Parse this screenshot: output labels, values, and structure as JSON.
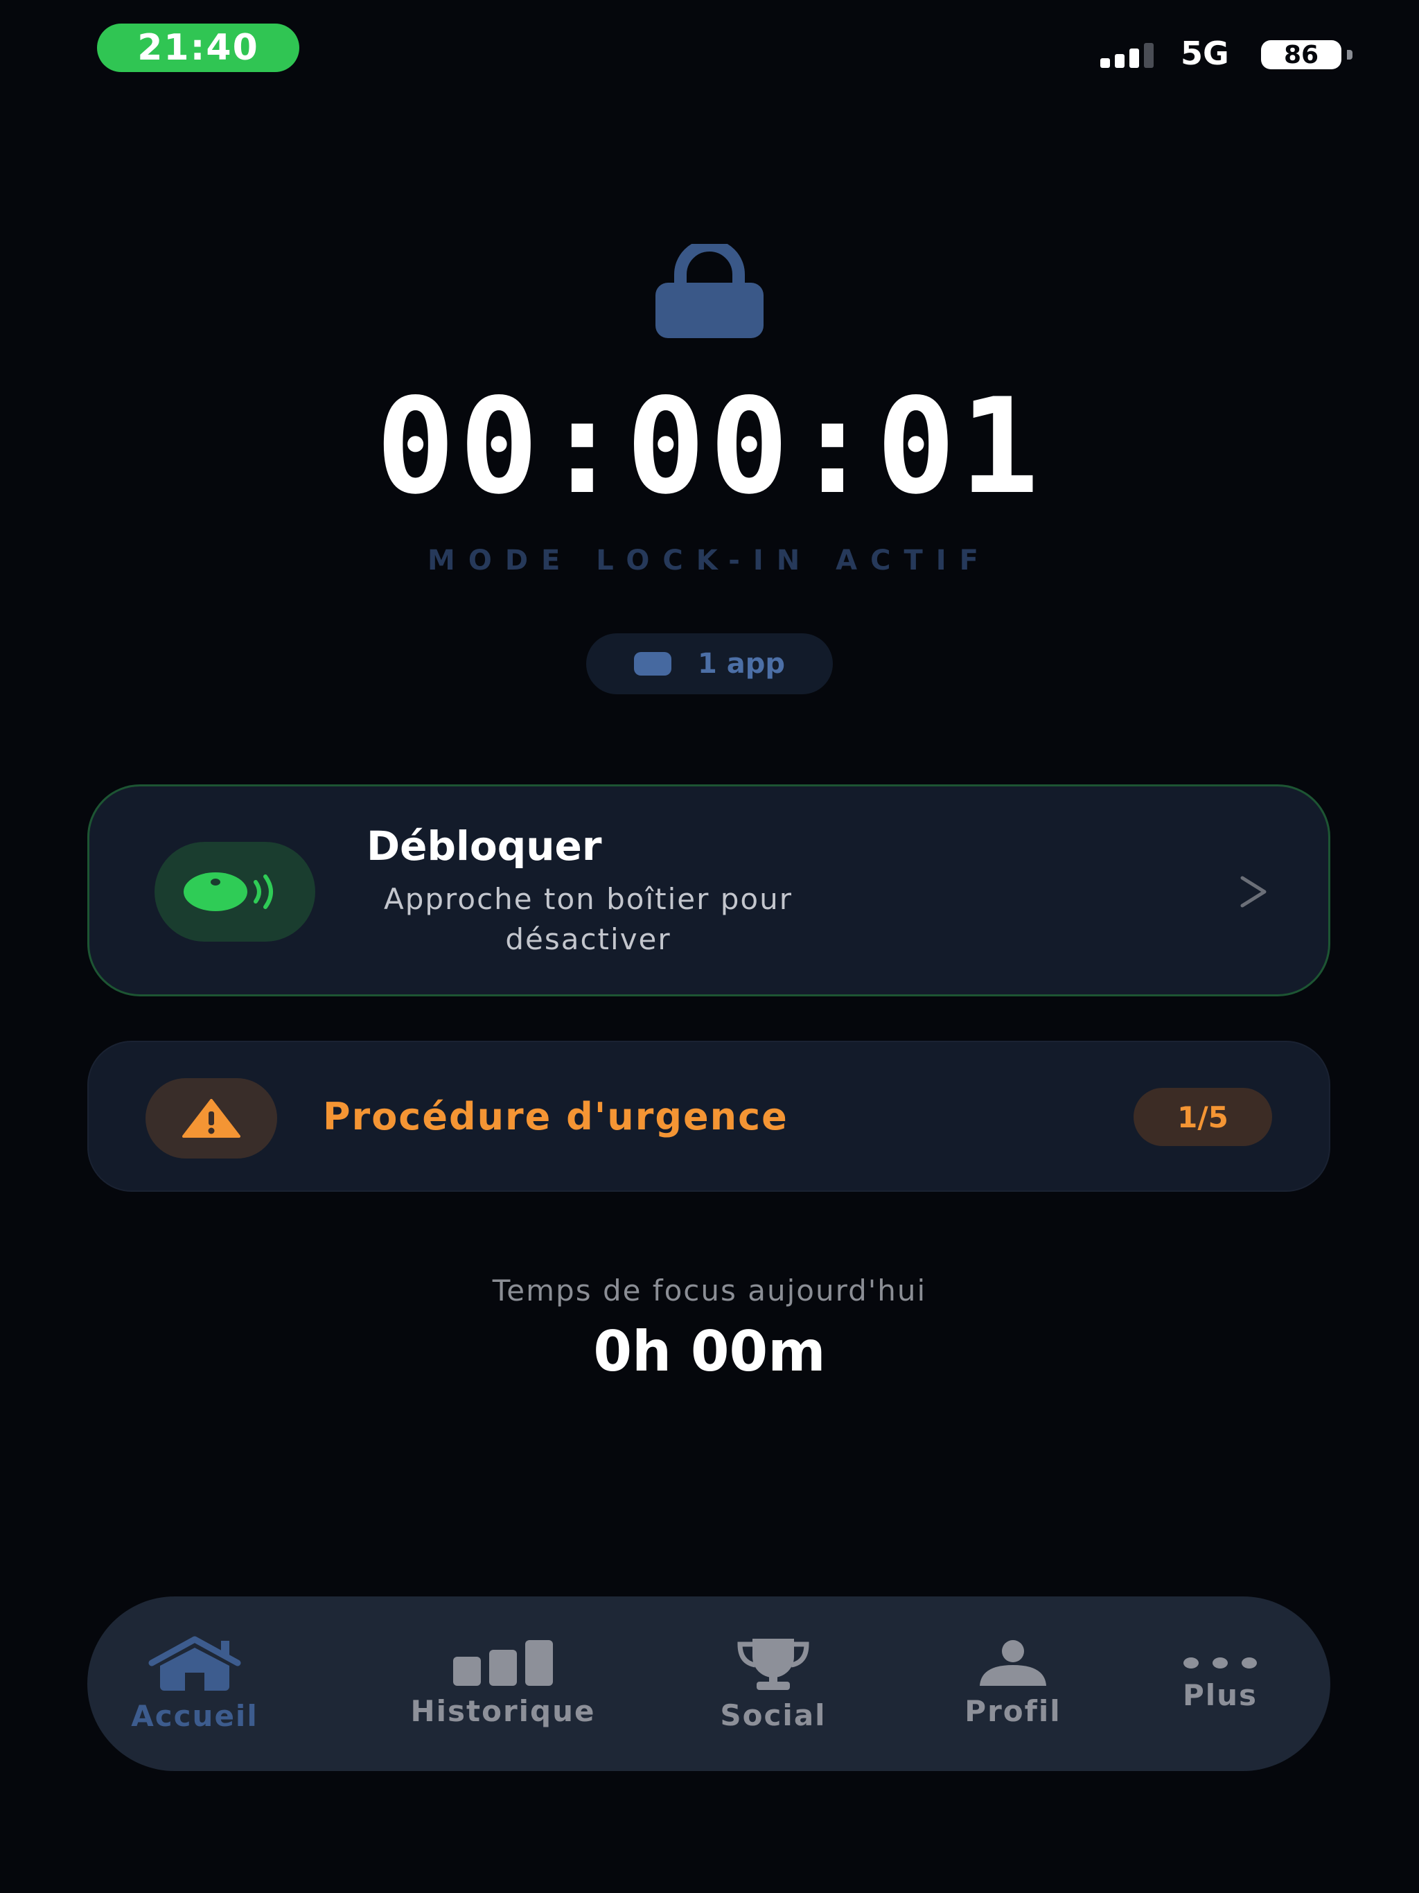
{
  "status_bar": {
    "time": "21:40",
    "network": "5G",
    "battery": "86"
  },
  "session": {
    "timer": "00:00:01",
    "mode_label": "MODE LOCK-IN ACTIF",
    "apps_blocked": "1 app"
  },
  "unlock_card": {
    "title": "Débloquer",
    "subtitle": "Approche ton boîtier pour désactiver"
  },
  "emergency_card": {
    "title": "Procédure d'urgence",
    "badge": "1/5"
  },
  "focus": {
    "label": "Temps de focus aujourd'hui",
    "value": "0h 00m"
  },
  "tab_bar": {
    "tabs": [
      {
        "label": "Accueil",
        "icon": "home-icon",
        "active": true
      },
      {
        "label": "Historique",
        "icon": "bar-chart-icon",
        "active": false
      },
      {
        "label": "Social",
        "icon": "trophy-icon",
        "active": false
      },
      {
        "label": "Profil",
        "icon": "person-icon",
        "active": false
      },
      {
        "label": "Plus",
        "icon": "more-dots-icon",
        "active": false
      }
    ]
  },
  "colors": {
    "background": "#05070c",
    "accent_blue": "#3d5c8e",
    "accent_green": "#30c553",
    "warning_orange": "#f49534",
    "card": "#131b2a"
  }
}
